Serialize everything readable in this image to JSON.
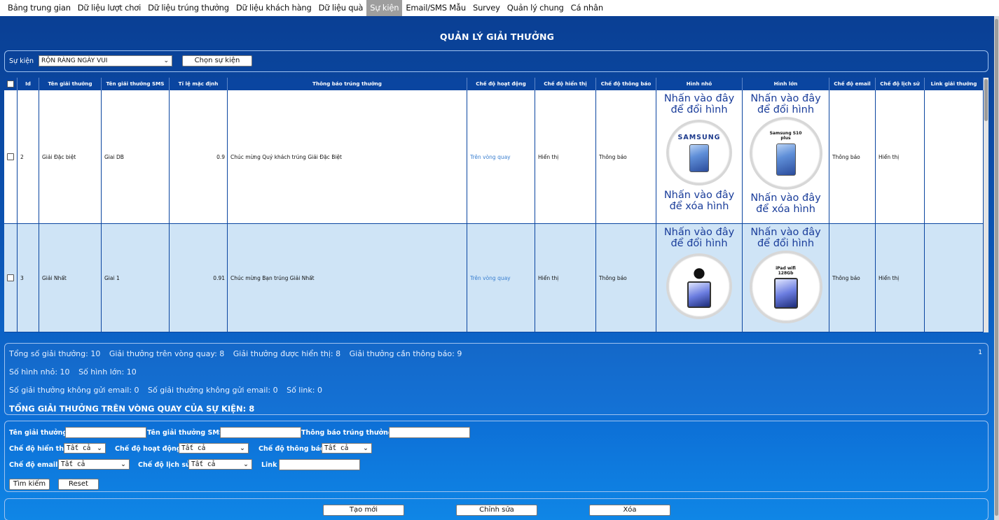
{
  "nav": {
    "items": [
      "Bảng trung gian",
      "Dữ liệu lượt chơi",
      "Dữ liệu trúng thưởng",
      "Dữ liệu khách hàng",
      "Dữ liệu quà",
      "Sự kiện",
      "Email/SMS Mẫu",
      "Survey",
      "Quản lý chung",
      "Cá nhân"
    ],
    "active": "Sự kiện"
  },
  "page": {
    "title": "QUẢN LÝ GIẢI THƯỞNG"
  },
  "event": {
    "label": "Sự kiện",
    "selected": "RỘN RÀNG NGÀY VUI",
    "choose_button": "Chọn sự kiện"
  },
  "table": {
    "columns": [
      "Id",
      "Tên giải thưởng",
      "Tên giải thưởng SMS",
      "Tỉ lệ mặc định",
      "Thông báo trúng thưởng",
      "Chế độ hoạt động",
      "Chế độ hiển thị",
      "Chế độ thông báo",
      "Hình nhỏ",
      "Hình lớn",
      "Chế độ email",
      "Chế độ lịch sử",
      "Link giải thưởng"
    ],
    "rows": [
      {
        "id": "2",
        "name": "Giải Đặc biệt",
        "sms_name": "Giai DB",
        "rate": "0.9",
        "message": "Chúc mừng Quý khách trúng Giải Đặc Biệt",
        "mode": "Trên vòng quay",
        "display": "Hiển thị",
        "notify": "Thông báo",
        "small_img": {
          "change": "Nhấn vào đây để đổi hình",
          "brand": "SAMSUNG",
          "delete": "Nhấn vào đây để xóa hình"
        },
        "large_img": {
          "change": "Nhấn vào đây để đổi hình",
          "caption": "Samsung S10 plus",
          "delete": "Nhấn vào đây để xóa hình"
        },
        "email": "Thông báo",
        "history": "Hiển thị",
        "link": ""
      },
      {
        "id": "3",
        "name": "Giải Nhất",
        "sms_name": "Giai 1",
        "rate": "0.91",
        "message": "Chúc mừng Bạn trúng Giải Nhất",
        "mode": "Trên vòng quay",
        "display": "Hiển thị",
        "notify": "Thông báo",
        "small_img": {
          "change": "Nhấn vào đây để đổi hình"
        },
        "large_img": {
          "change": "Nhấn vào đây để đổi hình",
          "caption": "iPad wifi 128Gb"
        },
        "email": "Thông báo",
        "history": "Hiển thị",
        "link": ""
      }
    ]
  },
  "stats": {
    "line1": [
      "Tổng số giải thưởng: 10",
      "Giải thưởng trên vòng quay: 8",
      "Giải thưởng được hiển thị: 8",
      "Giải thưởng cần thông báo: 9"
    ],
    "line2": [
      "Số hình nhỏ: 10",
      "Số hình lớn: 10"
    ],
    "line3": [
      "Số giải thưởng không gửi email: 0",
      "Số giải thưởng không gửi email: 0",
      "Số link: 0"
    ],
    "total": "TỔNG GIẢI THƯỞNG TRÊN VÒNG QUAY CỦA SỰ KIỆN: 8",
    "page": "1"
  },
  "filters": {
    "prize_name_label": "Tên giải thưởng",
    "sms_name_label": "Tên giải thưởng SMS",
    "message_label": "Thông báo trúng thưởng",
    "display_label": "Chế độ hiển thị",
    "display_value": "Tất cả",
    "mode_label": "Chế độ hoạt động",
    "mode_value": "Tất cả",
    "notify_label": "Chế độ thông báo",
    "notify_value": "Tất cả",
    "email_label": "Chế độ email",
    "email_value": "Tất cả",
    "history_label": "Chế độ lịch sử",
    "history_value": "Tất cả",
    "link_label": "Link",
    "search_button": "Tìm kiếm",
    "reset_button": "Reset"
  },
  "actions": {
    "create": "Tạo mới",
    "edit": "Chỉnh sửa",
    "delete": "Xóa"
  },
  "colors": {
    "header_blue": "#0a45a0",
    "row_alt": "#cfe4f6",
    "link_blue": "#3a7fd0",
    "image_text": "#1a3d9a"
  }
}
